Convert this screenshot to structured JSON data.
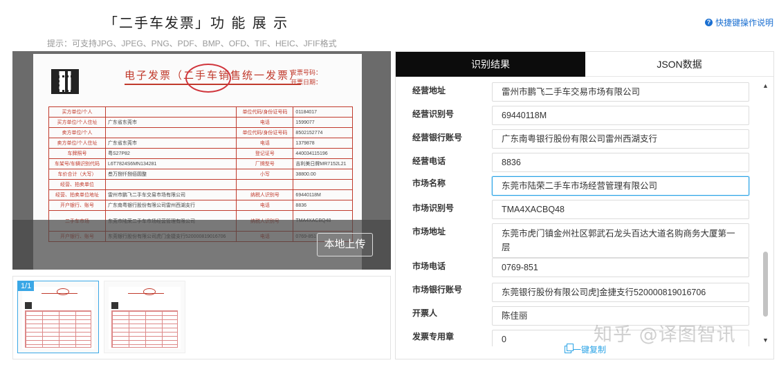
{
  "header": {
    "title": "「二手车发票」功 能 展 示",
    "subtitle": "提示：可支持JPG、JPEG、PNG、PDF、BMP、OFD、TIF、HEIC、JFIF格式",
    "help_label": "快捷键操作说明",
    "help_icon": "question-circle-icon"
  },
  "preview": {
    "upload_label": "本地上传",
    "invoice": {
      "title": "电子发票（二手车销售统一发票）",
      "number_label": "发票号码：",
      "date_label": "开票日期：",
      "rows": [
        [
          "买方单位/个人",
          "",
          "单位代码/身份证号码",
          "01184017"
        ],
        [
          "买方单位/个人住址",
          "广东省东莞市",
          "电话",
          "1599077"
        ],
        [
          "卖方单位/个人",
          "",
          "单位代码/身份证号码",
          "8502152774"
        ],
        [
          "卖方单位/个人住址",
          "广东省东莞市",
          "电话",
          "1379878"
        ],
        [
          "车牌照号",
          "粤S27P82",
          "登记证号",
          "440034115196"
        ],
        [
          "车架号/车辆识别代码",
          "L6T7824S6MN134281",
          "厂牌型号",
          "吉利美日牌MR7152L21"
        ],
        [
          "车价合计（大写）",
          "叁万捌仟捌佰圆整",
          "小写",
          "38800.00"
        ],
        [
          "经营、拍卖单位",
          "",
          "",
          ""
        ],
        [
          "经营、拍卖单位地址",
          "雷州市鹏飞二手车交易市场有限公司",
          "纳税人识别号",
          "69440118M"
        ],
        [
          "开户银行、账号",
          "广东南粤银行股份有限公司雷州西湖支行",
          "电话",
          "8836"
        ],
        [
          "二手车市场",
          "东莞市陆荣二手车市场经营管理有限公司",
          "纳税人识别号",
          "TMA4XACBQ48"
        ],
        [
          "开户银行、账号",
          "东莞银行股份有限公司虎门金捷支行520000819016706",
          "电话",
          "0769-851"
        ]
      ]
    }
  },
  "thumbnails": {
    "page_indicator": "1/1"
  },
  "tabs": [
    {
      "label": "识别结果",
      "active": true
    },
    {
      "label": "JSON数据",
      "active": false
    }
  ],
  "fields": [
    {
      "label": "经营地址",
      "value": "雷州市鹏飞二手车交易市场有限公司"
    },
    {
      "label": "经营识别号",
      "value": "69440118M"
    },
    {
      "label": "经营银行账号",
      "value": "广东南粤银行股份有限公司雷州西湖支行"
    },
    {
      "label": "经营电话",
      "value": "8836"
    },
    {
      "label": "市场名称",
      "value": "东莞市陆荣二手车市场经营管理有限公司"
    },
    {
      "label": "市场识别号",
      "value": "TMA4XACBQ48"
    },
    {
      "label": "市场地址",
      "value": "东莞市虎门镇金州社区郭武石龙头百达大道名购商务大厦第一层"
    },
    {
      "label": "市场电话",
      "value": "0769-851"
    },
    {
      "label": "市场银行账号",
      "value": "东莞银行股份有限公司虎]金捷支行520000819016706"
    },
    {
      "label": "开票人",
      "value": "陈佳丽"
    },
    {
      "label": "发票专用章",
      "value": "0"
    }
  ],
  "copy_label": "一键复制",
  "watermark": "知乎 @译图智讯",
  "colors": {
    "accent": "#2aa3e6",
    "tab_active_bg": "#0c0c0c",
    "invoice_red": "#c0392b"
  }
}
